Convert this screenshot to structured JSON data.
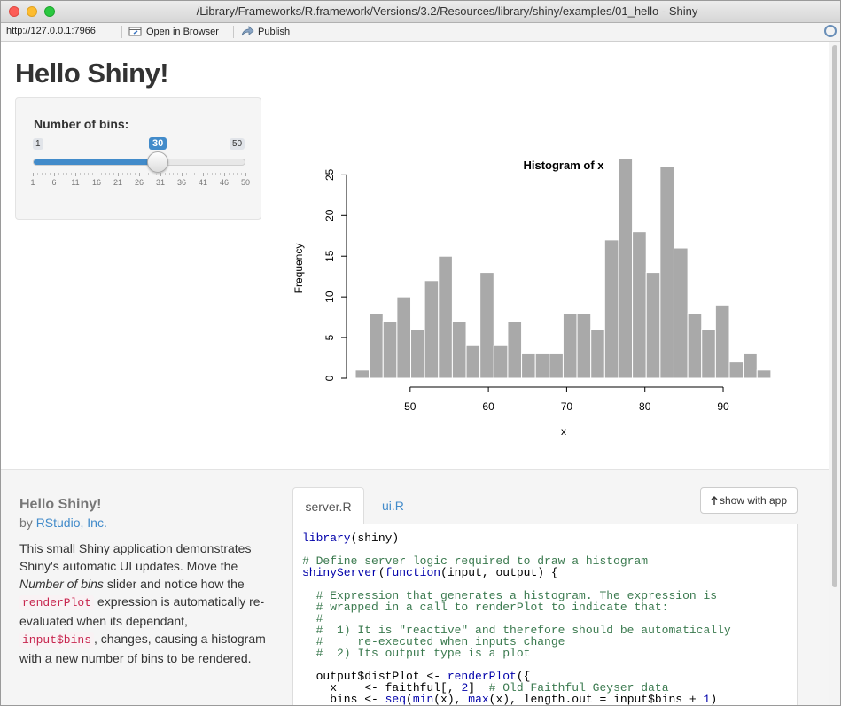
{
  "window": {
    "title": "/Library/Frameworks/R.framework/Versions/3.2/Resources/library/shiny/examples/01_hello - Shiny"
  },
  "toolbar": {
    "url": "http://127.0.0.1:7966",
    "open_label": "Open in Browser",
    "publish_label": "Publish"
  },
  "app": {
    "title": "Hello Shiny!"
  },
  "slider": {
    "label": "Number of bins:",
    "min": "1",
    "max": "50",
    "value": "30",
    "fill_fraction": 0.59,
    "ticks": [
      "1",
      "6",
      "11",
      "16",
      "21",
      "26",
      "31",
      "36",
      "41",
      "46",
      "50"
    ]
  },
  "chart_data": {
    "type": "bar",
    "title": "Histogram of x",
    "xlabel": "x",
    "ylabel": "Frequency",
    "bin_width": 1.77,
    "bin_start": 43,
    "values": [
      1,
      8,
      7,
      10,
      6,
      12,
      15,
      7,
      4,
      13,
      4,
      7,
      3,
      3,
      3,
      8,
      8,
      6,
      17,
      27,
      18,
      13,
      26,
      16,
      8,
      6,
      9,
      2,
      3,
      1
    ],
    "xticks": [
      "50",
      "60",
      "70",
      "80",
      "90"
    ],
    "xtick_values": [
      50,
      60,
      70,
      80,
      90
    ],
    "yticks": [
      "0",
      "5",
      "10",
      "15",
      "20",
      "25"
    ],
    "ytick_values": [
      0,
      5,
      10,
      15,
      20,
      25
    ],
    "xlim": [
      43,
      96
    ],
    "ylim": [
      0,
      27
    ],
    "bar_color": "#a9a9a9"
  },
  "about": {
    "title": "Hello Shiny!",
    "by": "by",
    "author": "RStudio, Inc.",
    "desc_1": "This small Shiny application demonstrates Shiny's automatic UI updates. Move the",
    "desc_italic": "Number of bins",
    "desc_2": "slider and notice how the",
    "code_1": "renderPlot",
    "desc_3": "expression is automatically re-evaluated when its dependant,",
    "code_2": "input$bins",
    "desc_4": ", changes, causing a histogram with a new number of bins to be rendered."
  },
  "tabs": {
    "server": "server.R",
    "ui": "ui.R"
  },
  "show_button": {
    "label": "show with app"
  },
  "code": {
    "lines": [
      "library(shiny)",
      "",
      "# Define server logic required to draw a histogram",
      "shinyServer(function(input, output) {",
      "",
      "  # Expression that generates a histogram. The expression is",
      "  # wrapped in a call to renderPlot to indicate that:",
      "  #",
      "  #  1) It is \"reactive\" and therefore should be automatically",
      "  #     re-executed when inputs change",
      "  #  2) Its output type is a plot",
      "",
      "  output$distPlot <- renderPlot({",
      "    x    <- faithful[, 2]  # Old Faithful Geyser data",
      "    bins <- seq(min(x), max(x), length.out = input$bins + 1)"
    ]
  },
  "colors": {
    "accent": "#428bca",
    "link": "#428bca",
    "code_inline": "#c7254e",
    "comment": "#3b7a4f"
  }
}
